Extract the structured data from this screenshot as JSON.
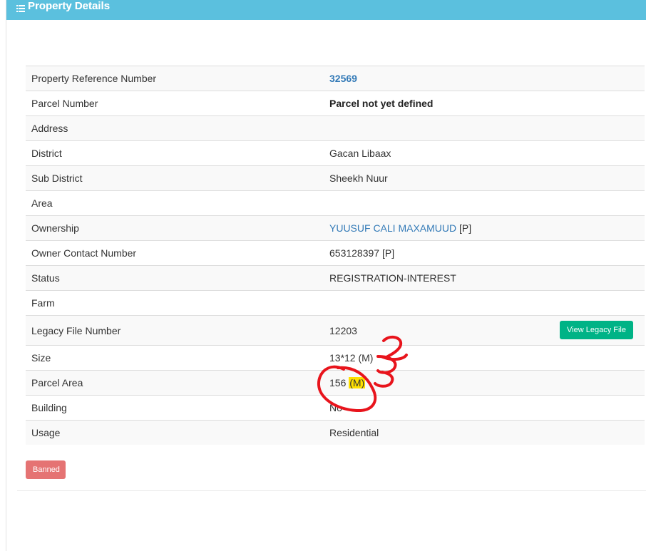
{
  "header": {
    "title": "Property Details",
    "icon": "list-icon",
    "color": "#5bc0de"
  },
  "rows": [
    {
      "label": "Property Reference Number",
      "value": "32569"
    },
    {
      "label": "Parcel Number",
      "value": "Parcel not yet defined"
    },
    {
      "label": "Address",
      "value": ""
    },
    {
      "label": "District",
      "value": "Gacan Libaax"
    },
    {
      "label": "Sub District",
      "value": "Sheekh Nuur"
    },
    {
      "label": "Area",
      "value": ""
    },
    {
      "label": "Ownership",
      "value": "YUUSUF CALI MAXAMUUD",
      "suffix": "[P]"
    },
    {
      "label": "Owner Contact Number",
      "value": "653128397 [P]"
    },
    {
      "label": "Status",
      "value": "REGISTRATION-INTEREST"
    },
    {
      "label": "Farm",
      "value": ""
    },
    {
      "label": "Legacy File Number",
      "value": "12203"
    },
    {
      "label": "Size",
      "value": "13*12 (M)"
    },
    {
      "label": "Parcel Area",
      "value": "156",
      "unit": "(M)"
    },
    {
      "label": "Building",
      "value": "No"
    },
    {
      "label": "Usage",
      "value": "Residential"
    }
  ],
  "buttons": {
    "view_legacy_file": "View Legacy File",
    "banned": "Banned"
  },
  "colors": {
    "accent": "#5bc0de",
    "link": "#337ab7",
    "legacy_button": "#00b386",
    "banned_button": "#e57373",
    "annotation": "#e8141c",
    "highlight": "#ffe000"
  }
}
